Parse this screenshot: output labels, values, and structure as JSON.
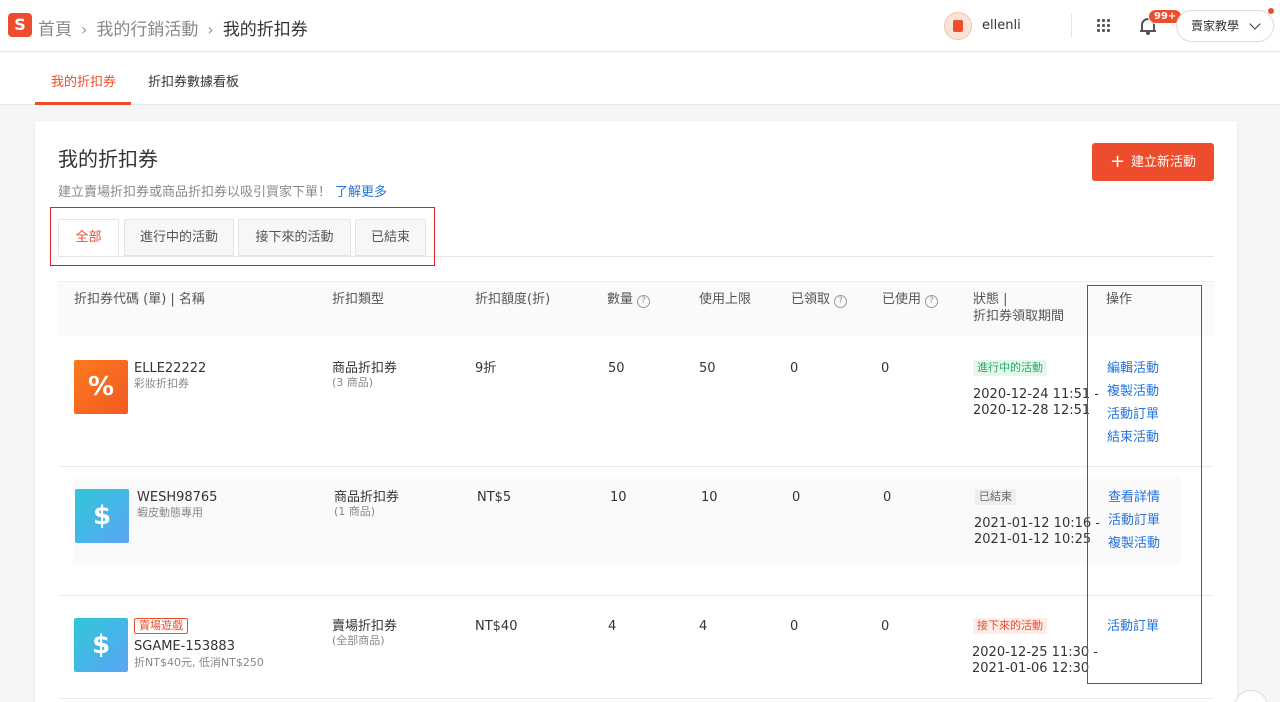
{
  "breadcrumb": {
    "home": "首頁",
    "marketing": "我的行銷活動",
    "current": "我的折扣券"
  },
  "user": {
    "name": "ellenli"
  },
  "notifications": {
    "count": "99+"
  },
  "help_menu": {
    "label": "賣家教學"
  },
  "subnav": {
    "tab1": "我的折扣券",
    "tab2": "折扣券數據看板"
  },
  "page": {
    "title": "我的折扣券",
    "description": "建立賣場折扣券或商品折扣券以吸引買家下單！",
    "learn_more": "了解更多",
    "create_button": "建立新活動"
  },
  "filter_tabs": {
    "all": "全部",
    "ongoing": "進行中的活動",
    "upcoming": "接下來的活動",
    "ended": "已結束"
  },
  "table": {
    "headers": {
      "code_name": "折扣券代碼 (單) | 名稱",
      "type": "折扣類型",
      "discount": "折扣額度(折)",
      "quantity": "數量",
      "usage_limit": "使用上限",
      "claimed": "已領取",
      "used": "已使用",
      "status_line1": "狀態 |",
      "status_line2": "折扣券領取期間",
      "actions": "操作"
    },
    "rows": [
      {
        "code": "ELLE22222",
        "name": "彩妝折扣券",
        "thumb_symbol": "%",
        "type": "商品折扣券",
        "type_sub": "(3 商品)",
        "discount": "9折",
        "quantity": "50",
        "usage_limit": "50",
        "claimed": "0",
        "used": "0",
        "status": "進行中的活動",
        "period_start": "2020-12-24 11:51 -",
        "period_end": "2020-12-28 12:51",
        "actions": [
          "編輯活動",
          "複製活動",
          "活動訂單",
          "結束活動"
        ]
      },
      {
        "code": "WESH98765",
        "name": "蝦皮動態專用",
        "thumb_symbol": "$",
        "type": "商品折扣券",
        "type_sub": "(1 商品)",
        "discount": "NT$5",
        "quantity": "10",
        "usage_limit": "10",
        "claimed": "0",
        "used": "0",
        "status": "已結束",
        "period_start": "2021-01-12 10:16 -",
        "period_end": "2021-01-12 10:25",
        "actions": [
          "查看詳情",
          "活動訂單",
          "複製活動"
        ]
      },
      {
        "tag": "賣場遊戲",
        "code": "SGAME-153883",
        "name": "折NT$40元, 低消NT$250",
        "thumb_symbol": "$",
        "type": "賣場折扣券",
        "type_sub": "(全部商品)",
        "discount": "NT$40",
        "quantity": "4",
        "usage_limit": "4",
        "claimed": "0",
        "used": "0",
        "status": "接下來的活動",
        "period_start": "2020-12-25 11:30 -",
        "period_end": "2021-01-06 12:30",
        "actions": [
          "活動訂單"
        ]
      }
    ]
  },
  "colors": {
    "brand": "#ee4d2d",
    "link": "#2673dd",
    "ongoing": "#26aa61"
  }
}
